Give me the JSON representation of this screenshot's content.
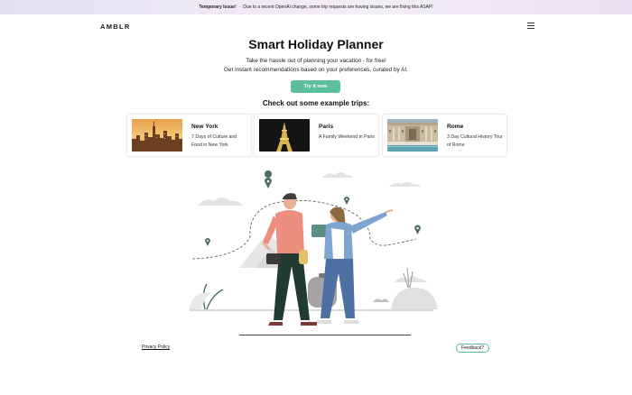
{
  "banner": {
    "label": "Temporary Issue!",
    "separator": "-",
    "message": "Due to a recent OpenAI change, some trip requests are having issues, we are fixing this ASAP!"
  },
  "header": {
    "logo": "AMBLR",
    "menu_icon": "hamburger-menu-icon"
  },
  "hero": {
    "title": "Smart Holiday Planner",
    "subtitle_line1": "Take the hassle out of planning your vacation - for free!",
    "subtitle_line2": "Get instant recommendations based on your preferences, curated by AI.",
    "cta_label": "Try it now"
  },
  "examples": {
    "heading": "Check out some example trips:",
    "trips": [
      {
        "city": "New York",
        "description": "7 Days of Culture and Food in New York"
      },
      {
        "city": "Paris",
        "description": "A Family Weekend in Paris"
      },
      {
        "city": "Rome",
        "description": "3 Day Cultural History Tour of Rome"
      }
    ]
  },
  "footer": {
    "privacy_label": "Privacy Policy",
    "feedback_label": "Feedback?"
  },
  "colors": {
    "accent": "#5bbf9f",
    "banner_bg": "#ece7f5",
    "text": "#111111"
  }
}
